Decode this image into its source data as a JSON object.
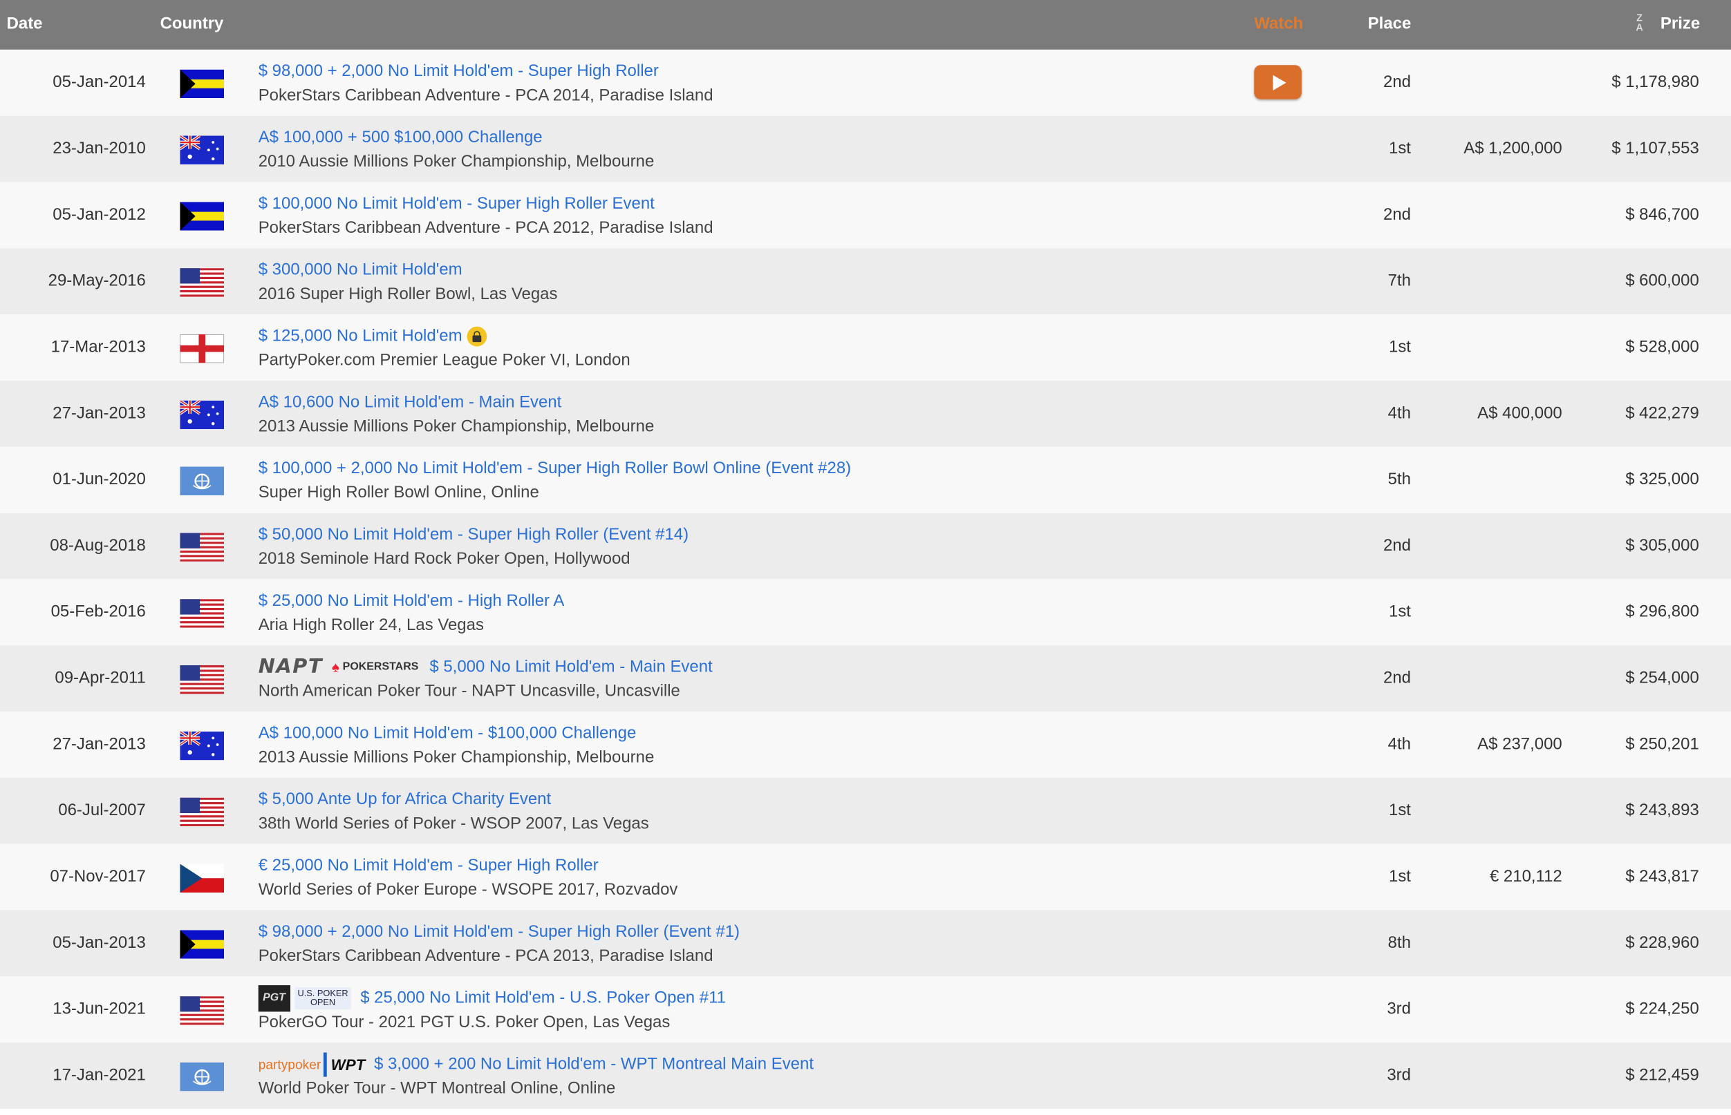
{
  "header": {
    "date": "Date",
    "country": "Country",
    "watch": "Watch",
    "place": "Place",
    "prize": "Prize",
    "sort_icon": "z-a-sort-icon"
  },
  "colors": {
    "header_bg": "#7b7b7b",
    "watch": "#e07a2e",
    "link": "#2a6fd6"
  },
  "rows": [
    {
      "date": "05-Jan-2014",
      "flag": "bahamas",
      "event": "$ 98,000 + 2,000 No Limit Hold'em - Super High Roller",
      "series": "PokerStars Caribbean Adventure - PCA 2014, Paradise Island",
      "place": "2nd",
      "local": "",
      "prize": "$ 1,178,980",
      "watch": true
    },
    {
      "date": "23-Jan-2010",
      "flag": "australia",
      "event": "A$ 100,000 + 500 $100,000 Challenge",
      "series": "2010 Aussie Millions Poker Championship, Melbourne",
      "place": "1st",
      "local": "A$ 1,200,000",
      "prize": "$ 1,107,553"
    },
    {
      "date": "05-Jan-2012",
      "flag": "bahamas",
      "event": "$ 100,000 No Limit Hold'em - Super High Roller Event",
      "series": "PokerStars Caribbean Adventure - PCA 2012, Paradise Island",
      "place": "2nd",
      "local": "",
      "prize": "$ 846,700"
    },
    {
      "date": "29-May-2016",
      "flag": "usa",
      "event": "$ 300,000 No Limit Hold'em",
      "series": "2016 Super High Roller Bowl, Las Vegas",
      "place": "7th",
      "local": "",
      "prize": "$ 600,000"
    },
    {
      "date": "17-Mar-2013",
      "flag": "england",
      "event": "$ 125,000 No Limit Hold'em",
      "series": "PartyPoker.com Premier League Poker VI, London",
      "place": "1st",
      "local": "",
      "prize": "$ 528,000",
      "lock": true
    },
    {
      "date": "27-Jan-2013",
      "flag": "australia",
      "event": "A$ 10,600 No Limit Hold'em - Main Event",
      "series": "2013 Aussie Millions Poker Championship, Melbourne",
      "place": "4th",
      "local": "A$ 400,000",
      "prize": "$ 422,279"
    },
    {
      "date": "01-Jun-2020",
      "flag": "un",
      "event": "$ 100,000 + 2,000 No Limit Hold'em - Super High Roller Bowl Online (Event #28)",
      "series": "Super High Roller Bowl Online, Online",
      "place": "5th",
      "local": "",
      "prize": "$ 325,000"
    },
    {
      "date": "08-Aug-2018",
      "flag": "usa",
      "event": "$ 50,000 No Limit Hold'em - Super High Roller (Event #14)",
      "series": "2018 Seminole Hard Rock Poker Open, Hollywood",
      "place": "2nd",
      "local": "",
      "prize": "$ 305,000"
    },
    {
      "date": "05-Feb-2016",
      "flag": "usa",
      "event": "$ 25,000 No Limit Hold'em - High Roller A",
      "series": "Aria High Roller 24, Las Vegas",
      "place": "1st",
      "local": "",
      "prize": "$ 296,800"
    },
    {
      "date": "09-Apr-2011",
      "flag": "usa",
      "event": "$ 5,000 No Limit Hold'em - Main Event",
      "series": "North American Poker Tour - NAPT Uncasville, Uncasville",
      "place": "2nd",
      "local": "",
      "prize": "$ 254,000",
      "logos": [
        "NAPT",
        "POKERSTARS"
      ]
    },
    {
      "date": "27-Jan-2013",
      "flag": "australia",
      "event": "A$ 100,000 No Limit Hold'em - $100,000 Challenge",
      "series": "2013 Aussie Millions Poker Championship, Melbourne",
      "place": "4th",
      "local": "A$ 237,000",
      "prize": "$ 250,201"
    },
    {
      "date": "06-Jul-2007",
      "flag": "usa",
      "event": "$ 5,000 Ante Up for Africa Charity Event",
      "series": "38th World Series of Poker - WSOP 2007, Las Vegas",
      "place": "1st",
      "local": "",
      "prize": "$ 243,893"
    },
    {
      "date": "07-Nov-2017",
      "flag": "czech",
      "event": "€ 25,000 No Limit Hold'em - Super High Roller",
      "series": "World Series of Poker Europe - WSOPE 2017, Rozvadov",
      "place": "1st",
      "local": "€ 210,112",
      "prize": "$ 243,817"
    },
    {
      "date": "05-Jan-2013",
      "flag": "bahamas",
      "event": "$ 98,000 + 2,000 No Limit Hold'em - Super High Roller (Event #1)",
      "series": "PokerStars Caribbean Adventure - PCA 2013, Paradise Island",
      "place": "8th",
      "local": "",
      "prize": "$ 228,960"
    },
    {
      "date": "13-Jun-2021",
      "flag": "usa",
      "event": "$ 25,000 No Limit Hold'em - U.S. Poker Open #11",
      "series": "PokerGO Tour - 2021 PGT U.S. Poker Open, Las Vegas",
      "place": "3rd",
      "local": "",
      "prize": "$ 224,250",
      "logos": [
        "PGT",
        "U.S. POKER OPEN"
      ]
    },
    {
      "date": "17-Jan-2021",
      "flag": "un",
      "event": "$ 3,000 + 200 No Limit Hold'em - WPT Montreal Main Event",
      "series": "World Poker Tour - WPT Montreal Online, Online",
      "place": "3rd",
      "local": "",
      "prize": "$ 212,459",
      "logos": [
        "partypoker",
        "WPT"
      ]
    }
  ]
}
